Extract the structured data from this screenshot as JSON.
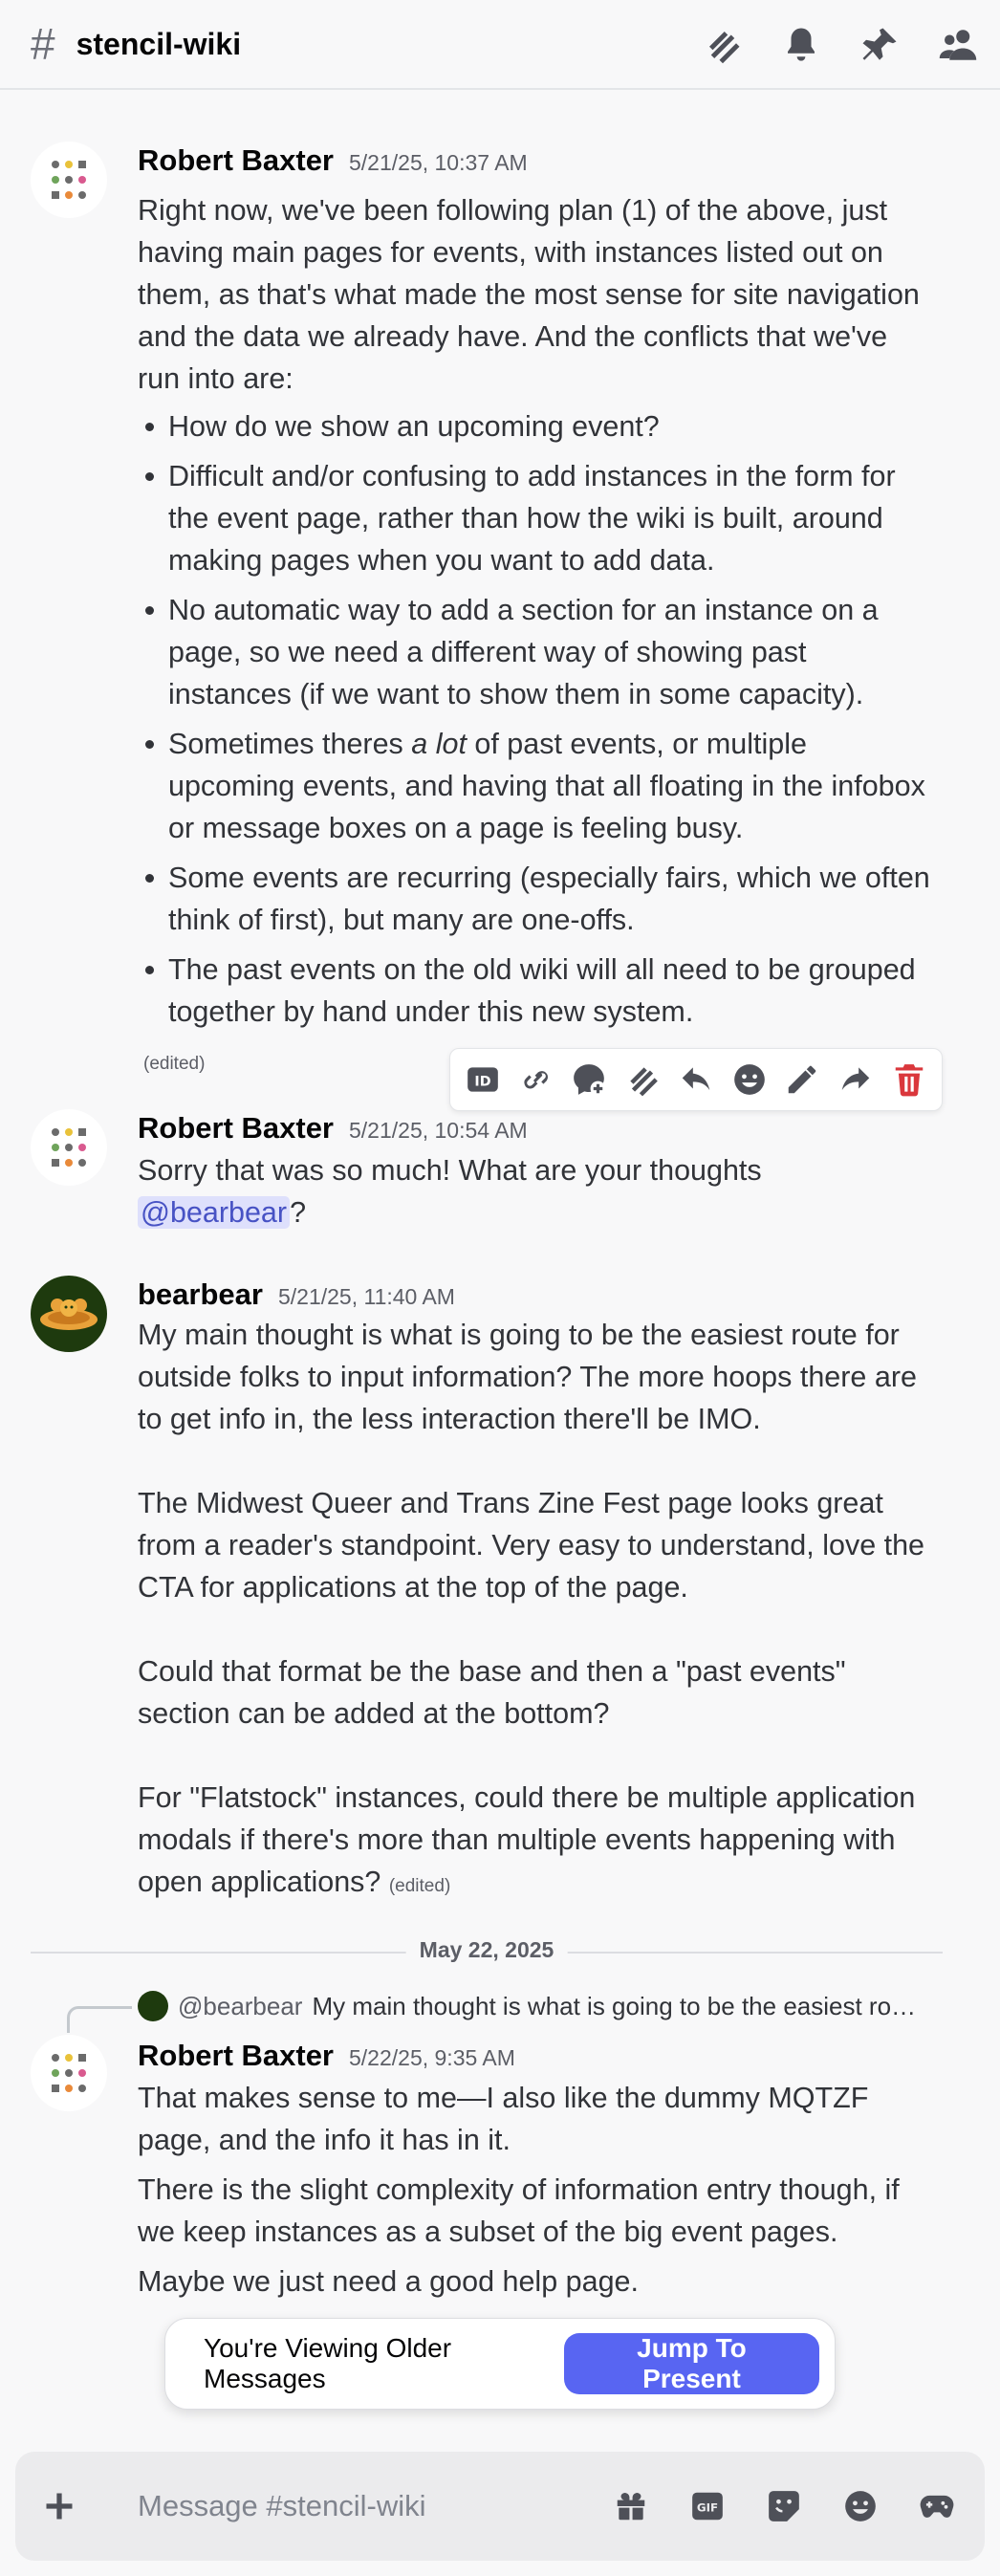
{
  "header": {
    "channel_name": "stencil-wiki",
    "icons": [
      "threads-icon",
      "bell-icon",
      "pin-icon",
      "members-icon"
    ]
  },
  "messages": [
    {
      "author": "Robert Baxter",
      "timestamp": "5/21/25, 10:37 AM",
      "intro": "Right now, we've been following plan (1) of the above, just having main pages for events, with instances listed out on them, as that's what made the most sense for site navigation and the data we already have. And the conflicts that we've run into are:",
      "bullets": [
        "How do we show an upcoming event?",
        "Difficult and/or confusing to add instances in the form for the event page, rather than how the wiki is built, around making pages when you want to add data.",
        "No automatic way to add a section for an instance on a page, so we need a different way of showing past instances (if we want to show them in some capacity).",
        "Some events are recurring (especially fairs, which we often think of first), but many are one-offs.",
        "The past events on the old wiki will all need to be grouped together by hand under this new system."
      ],
      "bullet4_pre": "Sometimes theres ",
      "bullet4_em": "a lot",
      "bullet4_post": " of past events, or multiple upcoming events, and having that all floating in the infobox or message boxes on a page is feeling busy.",
      "edited": "(edited)"
    },
    {
      "author": "Robert Baxter",
      "timestamp": "5/21/25, 10:54 AM",
      "text": "Sorry that was so much! What are your thoughts ",
      "mention": "@bearbear",
      "text_after": "?"
    },
    {
      "author": "bearbear",
      "timestamp": "5/21/25, 11:40 AM",
      "paragraphs": [
        "My main thought is what is going to be the easiest route for outside folks to input information? The more hoops there are to get info in, the less interaction there'll be IMO.",
        "The Midwest Queer and Trans Zine Fest page looks great from a reader's standpoint. Very easy to understand, love the CTA for applications at the top of the page.",
        "Could that format be the base and then a \"past events\" section can be added at the bottom?",
        "For \"Flatstock\" instances, could there be multiple application modals if there's more than multiple events happening with open applications? "
      ],
      "edited": "(edited)"
    },
    {
      "author": "Robert Baxter",
      "timestamp": "5/22/25, 9:35 AM",
      "reply_name": "@bearbear",
      "reply_text": "My main thought is what is going to be the easiest route for outside folks to input information? The more hoops there are to get info in, the less interaction there'll be IMO.",
      "lines": [
        "That makes sense to me—I also like the dummy MQTZF page, and the info it has in it.",
        "There is the slight complexity of information entry though, if we keep instances as a subset of the big event pages.",
        "Maybe we just need a good help page."
      ]
    }
  ],
  "date_divider": "May 22, 2025",
  "toolbar": [
    "id-icon",
    "link-icon",
    "add-reaction-icon",
    "thread-icon",
    "reply-icon",
    "emoji-icon",
    "edit-icon",
    "forward-icon",
    "delete-icon"
  ],
  "older_bar": {
    "text": "You're Viewing Older Messages",
    "button": "Jump To Present"
  },
  "composer": {
    "placeholder": "Message #stencil-wiki",
    "icons": [
      "gift-icon",
      "gif-icon",
      "sticker-icon",
      "emoji-icon",
      "activity-icon"
    ]
  },
  "colors": {
    "accent": "#5865f2",
    "mention_bg": "#dee0fc",
    "delete": "#da373c"
  }
}
